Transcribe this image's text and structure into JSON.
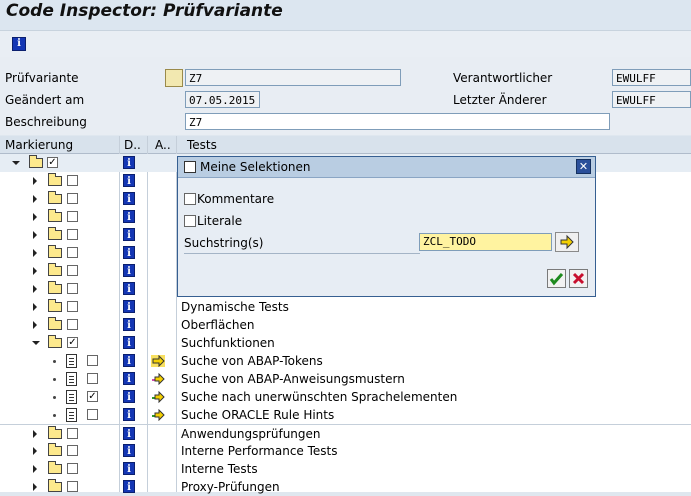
{
  "window": {
    "title": "Code Inspector: Prüfvariante"
  },
  "form": {
    "pruefvariante_label": "Prüfvariante",
    "pruefvariante_value": "Z7",
    "geaendert_label": "Geändert am",
    "geaendert_value": "07.05.2015",
    "beschreibung_label": "Beschreibung",
    "beschreibung_value": "Z7",
    "verantwortlicher_label": "Verantwortlicher",
    "verantwortlicher_value": "EWULFF",
    "letzter_aenderer_label": "Letzter Änderer",
    "letzter_aenderer_value": "EWULFF"
  },
  "tree": {
    "headers": {
      "markierung": "Markierung",
      "d": "D..",
      "a": "A..",
      "tests": "Tests"
    },
    "rows": [
      {
        "text": "",
        "checked": true
      },
      {
        "text": "",
        "checked": false
      },
      {
        "text": "",
        "checked": false
      },
      {
        "text": "",
        "checked": false
      },
      {
        "text": "",
        "checked": false
      },
      {
        "text": "",
        "checked": false
      },
      {
        "text": "",
        "checked": false
      },
      {
        "text": "",
        "checked": false
      },
      {
        "text": "Dynamische Tests",
        "checked": false
      },
      {
        "text": "Oberflächen",
        "checked": false
      },
      {
        "text": "Suchfunktionen",
        "checked": true
      },
      {
        "text": "Suche von ABAP-Tokens",
        "checked": false
      },
      {
        "text": "Suche von ABAP-Anweisungsmustern",
        "checked": false
      },
      {
        "text": "Suche nach unerwünschten Sprachelementen",
        "checked": true
      },
      {
        "text": "Suche ORACLE Rule Hints",
        "checked": false
      },
      {
        "text": "Anwendungsprüfungen",
        "checked": false
      },
      {
        "text": "Interne Performance Tests",
        "checked": false
      },
      {
        "text": "Interne Tests",
        "checked": false
      },
      {
        "text": "Proxy-Prüfungen",
        "checked": false
      }
    ]
  },
  "dialog": {
    "title": "Meine Selektionen",
    "kommentare_label": "Kommentare",
    "literale_label": "Literale",
    "suchstring_label": "Suchstring(s)",
    "suchstring_value": "ZCL_TODO"
  },
  "colors": {
    "accent": "#1436b4",
    "search_bg": "#fff3a0"
  }
}
